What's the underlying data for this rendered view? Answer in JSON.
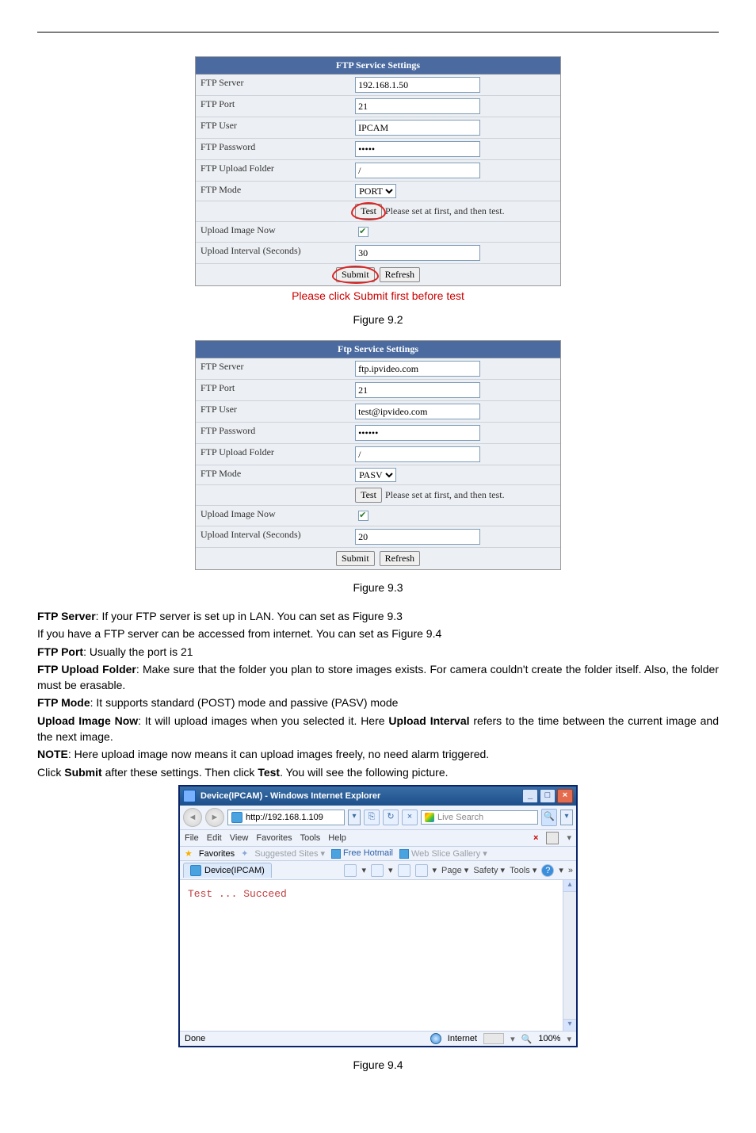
{
  "panel1": {
    "title": "FTP Service Settings",
    "rows": {
      "server": {
        "label": "FTP Server",
        "value": "192.168.1.50"
      },
      "port": {
        "label": "FTP Port",
        "value": "21"
      },
      "user": {
        "label": "FTP User",
        "value": "IPCAM"
      },
      "pass": {
        "label": "FTP Password",
        "value": "•••••"
      },
      "folder": {
        "label": "FTP Upload Folder",
        "value": "/"
      },
      "mode": {
        "label": "FTP Mode",
        "value": "PORT"
      },
      "test_btn": "Test",
      "test_note": "Please set at first, and then test.",
      "upload_now": "Upload Image Now",
      "upload_now_checked": true,
      "interval": {
        "label": "Upload Interval (Seconds)",
        "value": "30"
      },
      "submit": "Submit",
      "refresh": "Refresh"
    },
    "annotation": "Please click Submit first before test",
    "caption": "Figure 9.2"
  },
  "panel2": {
    "title": "Ftp Service Settings",
    "rows": {
      "server": {
        "label": "FTP Server",
        "value": "ftp.ipvideo.com"
      },
      "port": {
        "label": "FTP Port",
        "value": "21"
      },
      "user": {
        "label": "FTP User",
        "value": "test@ipvideo.com"
      },
      "pass": {
        "label": "FTP Password",
        "value": "••••••"
      },
      "folder": {
        "label": "FTP Upload Folder",
        "value": "/"
      },
      "mode": {
        "label": "FTP Mode",
        "value": "PASV"
      },
      "test_btn": "Test",
      "test_note": "Please set at first, and then test.",
      "upload_now": "Upload Image Now",
      "upload_now_checked": true,
      "interval": {
        "label": "Upload Interval (Seconds)",
        "value": "20"
      },
      "submit": "Submit",
      "refresh": "Refresh"
    },
    "caption": "Figure 9.3"
  },
  "text": {
    "p1a": "FTP Server",
    "p1b": ": If your FTP server is set up in LAN. You can set as Figure 9.3",
    "p2": "If you have a FTP server can be accessed from internet. You can set as Figure 9.4",
    "p3a": "FTP Port",
    "p3b": ": Usually the port is 21",
    "p4a": "FTP Upload Folder",
    "p4b": ": Make sure that the folder you plan to store images exists. For camera couldn't create the folder itself. Also, the folder must be erasable.",
    "p5a": "FTP Mode",
    "p5b": ": It supports standard (POST) mode and passive (PASV) mode",
    "p6a": "Upload Image Now",
    "p6b": ": It will upload images when you selected it. Here ",
    "p6c": "Upload Interval",
    "p6d": " refers to the time between the current image and the next image.",
    "p7a": "NOTE",
    "p7b": ": Here upload image now means it can upload images freely, no need alarm triggered.",
    "p8a": "Click ",
    "p8b": "Submit",
    "p8c": " after these settings. Then click ",
    "p8d": "Test",
    "p8e": ". You will see the following picture."
  },
  "ie": {
    "title": "Device(IPCAM) - Windows Internet Explorer",
    "url": "http://192.168.1.109",
    "search_placeholder": "Live Search",
    "menu": {
      "file": "File",
      "edit": "Edit",
      "view": "View",
      "fav": "Favorites",
      "tools": "Tools",
      "help": "Help"
    },
    "fav_label": "Favorites",
    "suggested": "Suggested Sites ▾",
    "freehotmail": "Free Hotmail",
    "webslice": "Web Slice Gallery ▾",
    "tab_label": "Device(IPCAM)",
    "tb": {
      "page": "Page ▾",
      "safety": "Safety ▾",
      "tools": "Tools ▾"
    },
    "result": "Test ... Succeed",
    "status_done": "Done",
    "status_zone": "Internet",
    "zoom": "100%",
    "caption": "Figure 9.4"
  }
}
